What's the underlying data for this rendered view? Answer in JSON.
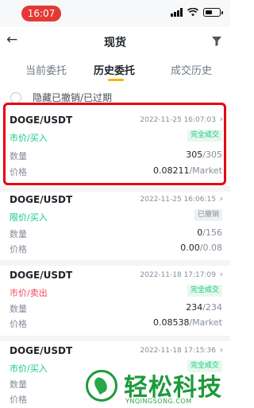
{
  "status_bar": {
    "time": "16:07"
  },
  "header": {
    "title": "现货",
    "back_icon": "arrow-left-icon",
    "filter_icon": "filter-icon"
  },
  "tabs": [
    {
      "label": "当前委托",
      "active": false
    },
    {
      "label": "历史委托",
      "active": true
    },
    {
      "label": "成交历史",
      "active": false
    }
  ],
  "hide_toggle": {
    "label": "隐藏已撤销/已过期",
    "checked": false
  },
  "colors": {
    "accent": "#f0b90b",
    "buy": "#0ecb81",
    "sell": "#f6465d",
    "highlight": "#e60012"
  },
  "orders": [
    {
      "pair": "DOGE/USDT",
      "time": "2022-11-25 16:07:03",
      "type": "市价/买入",
      "side": "buy",
      "status": "完全成交",
      "qty_label": "数量",
      "qty_filled": "305",
      "qty_total": "/305",
      "price_label": "价格",
      "price": "0.08211",
      "price_suffix": "/Market"
    },
    {
      "pair": "DOGE/USDT",
      "time": "2022-11-25 16:06:15",
      "type": "限价/买入",
      "side": "buy",
      "status": "已撤销",
      "qty_label": "数量",
      "qty_filled": "0",
      "qty_total": "/156",
      "price_label": "价格",
      "price": "0.00",
      "price_suffix": "/0.08"
    },
    {
      "pair": "DOGE/USDT",
      "time": "2022-11-18 17:17:09",
      "type": "市价/卖出",
      "side": "sell",
      "status": "完全成交",
      "qty_label": "数量",
      "qty_filled": "234",
      "qty_total": "/234",
      "price_label": "价格",
      "price": "0.08538",
      "price_suffix": "/Market"
    },
    {
      "pair": "DOGE/USDT",
      "time": "2022-11-18 17:15:36",
      "type": "市价/买入",
      "side": "buy",
      "status": "完全成交",
      "qty_label": "数量",
      "qty_filled": "",
      "qty_total": "",
      "price_label": "价格",
      "price": "",
      "price_suffix": ""
    }
  ],
  "watermark": {
    "text": "轻松科技",
    "url": "YNQINGSONG.COM"
  }
}
